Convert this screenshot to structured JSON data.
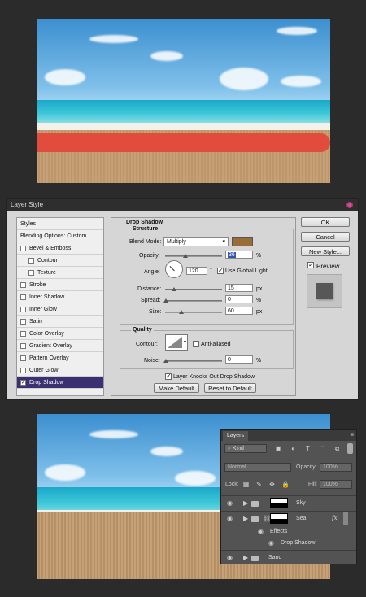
{
  "dialog": {
    "title": "Layer Style",
    "styles_list": [
      {
        "label": "Styles",
        "type": "header"
      },
      {
        "label": "Blending Options: Custom",
        "type": "header"
      },
      {
        "label": "Bevel & Emboss",
        "checked": false
      },
      {
        "label": "Contour",
        "checked": false,
        "sub": true
      },
      {
        "label": "Texture",
        "checked": false,
        "sub": true
      },
      {
        "label": "Stroke",
        "checked": false
      },
      {
        "label": "Inner Shadow",
        "checked": false
      },
      {
        "label": "Inner Glow",
        "checked": false
      },
      {
        "label": "Satin",
        "checked": false
      },
      {
        "label": "Color Overlay",
        "checked": false
      },
      {
        "label": "Gradient Overlay",
        "checked": false
      },
      {
        "label": "Pattern Overlay",
        "checked": false
      },
      {
        "label": "Outer Glow",
        "checked": false
      },
      {
        "label": "Drop Shadow",
        "checked": true,
        "selected": true
      }
    ],
    "section_title": "Drop Shadow",
    "structure": {
      "title": "Structure",
      "blend_mode_label": "Blend Mode:",
      "blend_mode_value": "Multiply",
      "shadow_color": "#9a6c3a",
      "opacity_label": "Opacity:",
      "opacity_value": "36",
      "angle_label": "Angle:",
      "angle_value": "120",
      "angle_unit": "°",
      "use_global_light": "Use Global Light",
      "distance_label": "Distance:",
      "distance_value": "15",
      "spread_label": "Spread:",
      "spread_value": "0",
      "size_label": "Size:",
      "size_value": "60",
      "unit_percent": "%",
      "unit_px": "px"
    },
    "quality": {
      "title": "Quality",
      "contour_label": "Contour:",
      "anti_aliased": "Anti-aliased",
      "noise_label": "Noise:",
      "noise_value": "0",
      "unit_percent": "%"
    },
    "knockout": "Layer Knocks Out Drop Shadow",
    "make_default": "Make Default",
    "reset_default": "Reset to Default",
    "ok": "OK",
    "cancel": "Cancel",
    "new_style": "New Style...",
    "preview": "Preview"
  },
  "layers_panel": {
    "tab": "Layers",
    "filter_kind": "Kind",
    "blend_mode": "Normal",
    "opacity_label": "Opacity:",
    "opacity_value": "100%",
    "lock_label": "Lock:",
    "fill_label": "Fill:",
    "fill_value": "100%",
    "layers": [
      {
        "name": "Sky"
      },
      {
        "name": "Sea",
        "fx": "fx"
      },
      {
        "name": "Effects"
      },
      {
        "name": "Drop Shadow"
      },
      {
        "name": "Sand"
      }
    ]
  }
}
